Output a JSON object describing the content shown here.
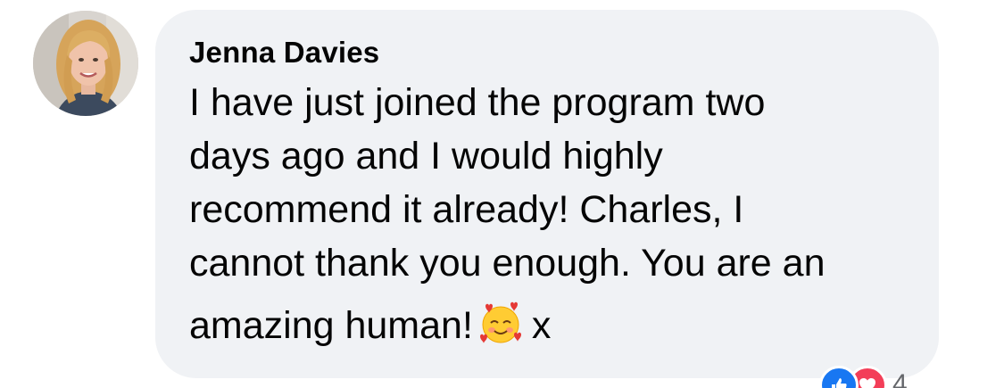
{
  "comment": {
    "author": "Jenna Davies",
    "lines": [
      "I have just joined the program two",
      "days ago and I would highly",
      "recommend it already! Charles, I",
      "cannot thank you enough. You are an",
      "amazing human!"
    ],
    "emoji": "smiling-face-with-hearts-icon",
    "trailing_text": "x"
  },
  "reactions": {
    "icons": [
      "like-icon",
      "love-icon"
    ],
    "count": "4"
  },
  "colors": {
    "bubble": "#f0f2f5",
    "text": "#050505",
    "like": "#1877f2",
    "love": "#f33e58",
    "meta": "#65676b"
  }
}
